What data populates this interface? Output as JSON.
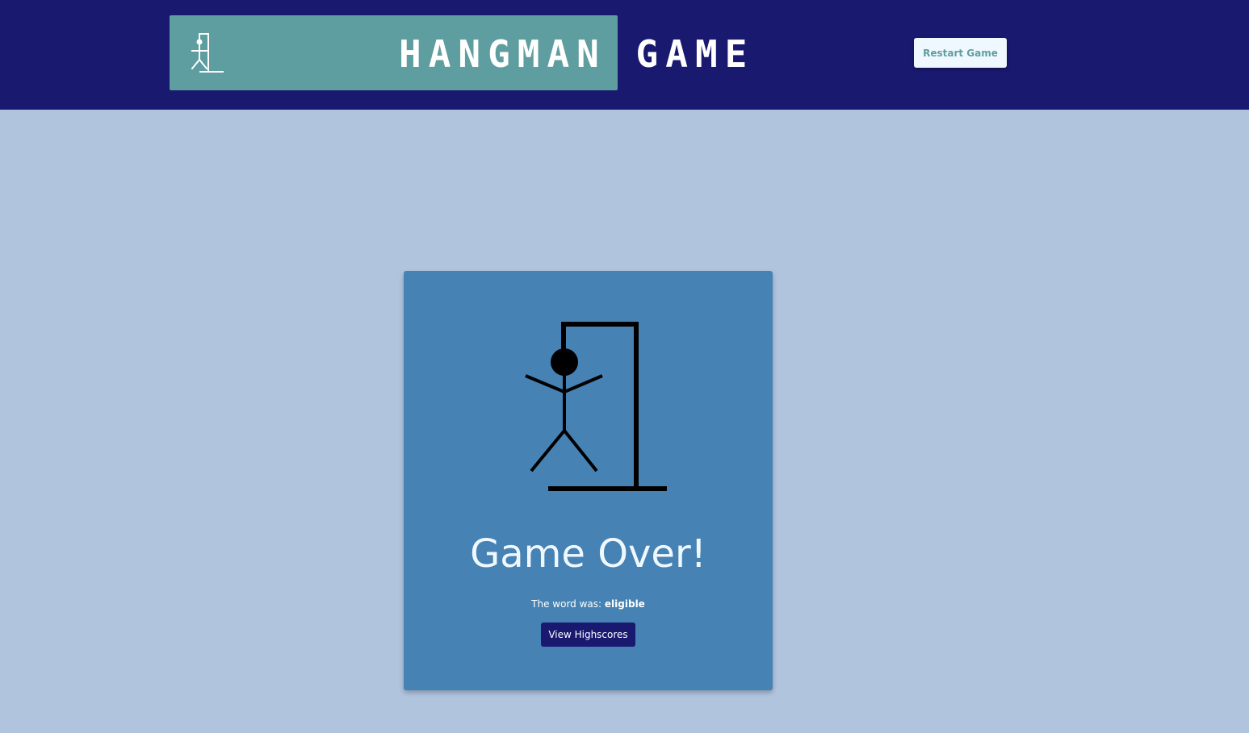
{
  "header": {
    "logo_text": "HANGMAN GAME",
    "restart_label": "Restart Game",
    "logo_icon": "hangman-logo-icon"
  },
  "game": {
    "status_title": "Game Over!",
    "word_prefix": "The word was:",
    "word": "eligible",
    "highscores_label": "View Highscores",
    "drawing_icon": "hangman-drawing-icon"
  },
  "colors": {
    "page_background": "#b0c4de",
    "header_background": "#191970",
    "logo_background": "#5f9ea0",
    "card_background": "#4682b4",
    "restart_button_background": "#f0f8ff",
    "restart_button_text": "#5f9ea0",
    "highscores_button_background": "#191970",
    "title_text": "#f0f8ff"
  }
}
